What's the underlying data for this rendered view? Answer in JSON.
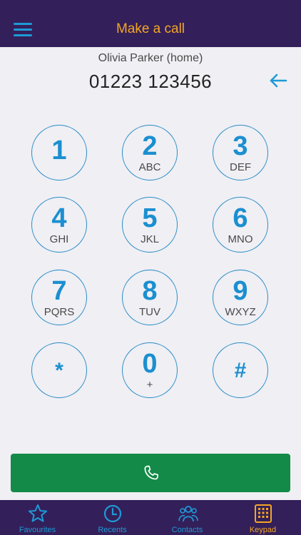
{
  "header": {
    "title": "Make a call",
    "menu_icon": "hamburger-menu-icon"
  },
  "dialer": {
    "contact_name": "Olivia Parker (home)",
    "number": "01223 123456",
    "backspace_icon": "backspace-arrow-icon"
  },
  "keypad": {
    "keys": [
      {
        "digit": "1",
        "letters": ""
      },
      {
        "digit": "2",
        "letters": "ABC"
      },
      {
        "digit": "3",
        "letters": "DEF"
      },
      {
        "digit": "4",
        "letters": "GHI"
      },
      {
        "digit": "5",
        "letters": "JKL"
      },
      {
        "digit": "6",
        "letters": "MNO"
      },
      {
        "digit": "7",
        "letters": "PQRS"
      },
      {
        "digit": "8",
        "letters": "TUV"
      },
      {
        "digit": "9",
        "letters": "WXYZ"
      },
      {
        "digit": "*",
        "letters": ""
      },
      {
        "digit": "0",
        "letters": "+"
      },
      {
        "digit": "#",
        "letters": ""
      }
    ]
  },
  "call_button": {
    "icon": "phone-icon"
  },
  "tabs": [
    {
      "label": "Favourites",
      "icon": "star-icon",
      "active": false
    },
    {
      "label": "Recents",
      "icon": "clock-icon",
      "active": false
    },
    {
      "label": "Contacts",
      "icon": "contacts-icon",
      "active": false
    },
    {
      "label": "Keypad",
      "icon": "keypad-icon",
      "active": true
    }
  ],
  "colors": {
    "bar_background": "#33205a",
    "accent_orange": "#f5a623",
    "accent_blue": "#1b8fd0",
    "call_green": "#138a47",
    "page_background": "#efeff4"
  }
}
